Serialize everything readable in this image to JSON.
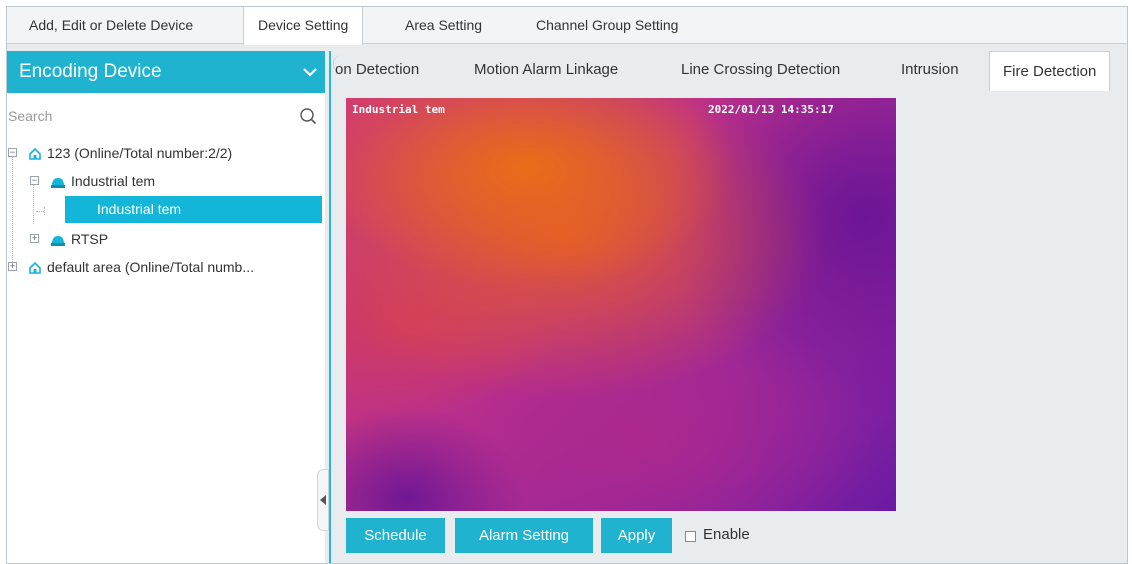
{
  "top_tabs": [
    {
      "label": "Add, Edit or Delete Device",
      "active": false
    },
    {
      "label": "Device Setting",
      "active": true
    },
    {
      "label": "Area Setting",
      "active": false
    },
    {
      "label": "Channel Group Setting",
      "active": false
    }
  ],
  "left_panel": {
    "title": "Encoding Device",
    "search_placeholder": "Search",
    "tree": {
      "area1": "123 (Online/Total number:2/2)",
      "device1": "Industrial tem",
      "channel1": "Industrial tem",
      "device2": "RTSP",
      "area2": "default area (Online/Total numb..."
    }
  },
  "sub_tabs": [
    {
      "label": "on Detection",
      "active": false
    },
    {
      "label": "Motion Alarm Linkage",
      "active": false
    },
    {
      "label": "Line Crossing Detection",
      "active": false
    },
    {
      "label": "Intrusion",
      "active": false
    },
    {
      "label": "Fire Detection",
      "active": true
    }
  ],
  "video": {
    "osd_name": "Industrial tem",
    "osd_time": "2022/01/13 14:35:17"
  },
  "actions": {
    "schedule": "Schedule",
    "alarm_setting": "Alarm Setting",
    "apply": "Apply",
    "enable_label": "Enable",
    "enable_checked": false
  },
  "colors": {
    "accent": "#1fb3cf",
    "selected": "#13b6d8"
  },
  "icons": [
    "chevron-down-icon",
    "search-icon",
    "home-icon",
    "camera-icon",
    "collapse-arrow-icon",
    "tree-toggle-icon"
  ]
}
